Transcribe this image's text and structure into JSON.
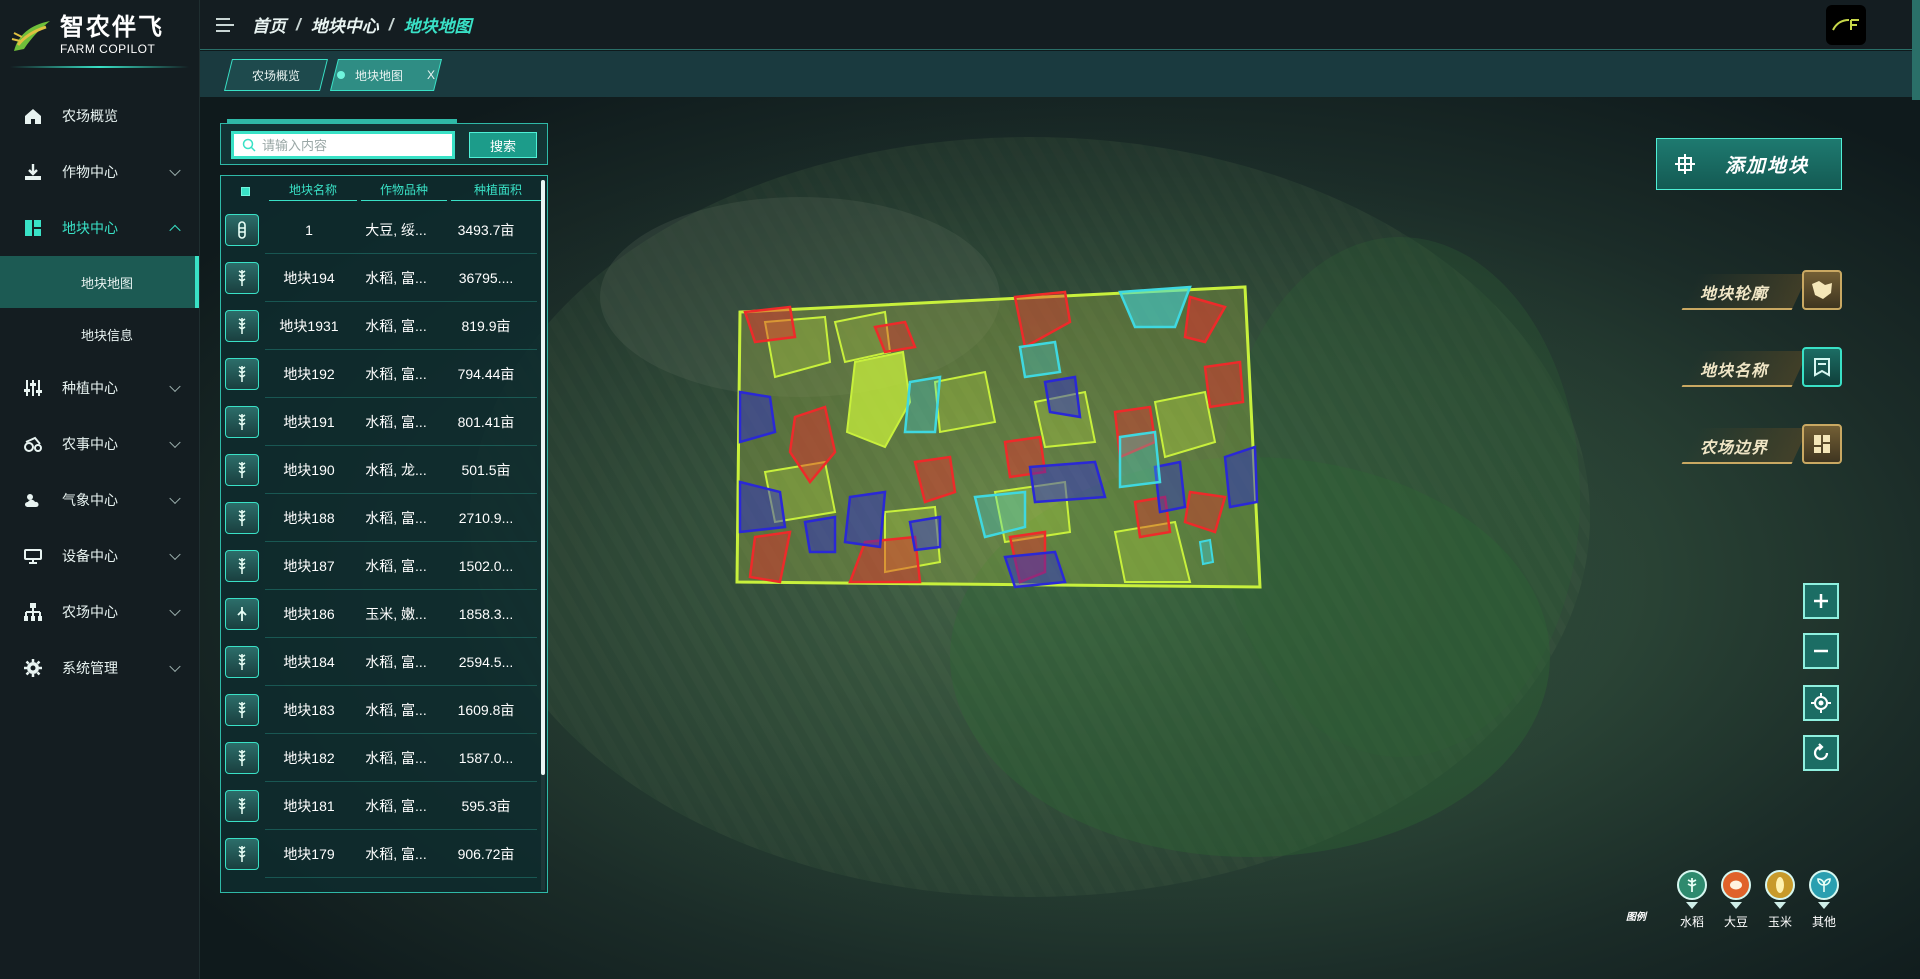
{
  "app": {
    "logo_title": "智农伴飞",
    "logo_sub": "FARM COPILOT"
  },
  "sidebar": {
    "items": [
      {
        "label": "农场概览",
        "icon": "home-icon",
        "expandable": false
      },
      {
        "label": "作物中心",
        "icon": "download-crop-icon",
        "expandable": true
      },
      {
        "label": "地块中心",
        "icon": "grid-blocks-icon",
        "expandable": true,
        "active": true
      },
      {
        "label": "种植中心",
        "icon": "sliders-icon",
        "expandable": true
      },
      {
        "label": "农事中心",
        "icon": "tractor-icon",
        "expandable": true
      },
      {
        "label": "气象中心",
        "icon": "weather-icon",
        "expandable": true
      },
      {
        "label": "设备中心",
        "icon": "device-icon",
        "expandable": true
      },
      {
        "label": "农场中心",
        "icon": "org-chart-icon",
        "expandable": true
      },
      {
        "label": "系统管理",
        "icon": "gear-icon",
        "expandable": true
      }
    ],
    "sub_items": [
      {
        "label": "地块地图",
        "active": true
      },
      {
        "label": "地块信息",
        "active": false
      }
    ]
  },
  "header": {
    "breadcrumb": [
      "首页",
      "地块中心",
      "地块地图"
    ],
    "separator": "/"
  },
  "tabs": [
    {
      "label": "农场概览",
      "active": false
    },
    {
      "label": "地块地图",
      "active": true,
      "close": "X"
    }
  ],
  "search": {
    "placeholder": "请输入内容",
    "button": "搜索"
  },
  "table": {
    "columns": [
      "地块名称",
      "作物品种",
      "种植面积"
    ],
    "rows": [
      {
        "name": "1",
        "crop": "大豆, 绥...",
        "area": "3493.7亩"
      },
      {
        "name": "地块194",
        "crop": "水稻, 富...",
        "area": "36795...."
      },
      {
        "name": "地块1931",
        "crop": "水稻, 富...",
        "area": "819.9亩"
      },
      {
        "name": "地块192",
        "crop": "水稻, 富...",
        "area": "794.44亩"
      },
      {
        "name": "地块191",
        "crop": "水稻, 富...",
        "area": "801.41亩"
      },
      {
        "name": "地块190",
        "crop": "水稻, 龙...",
        "area": "501.5亩"
      },
      {
        "name": "地块188",
        "crop": "水稻, 富...",
        "area": "2710.9..."
      },
      {
        "name": "地块187",
        "crop": "水稻, 富...",
        "area": "1502.0..."
      },
      {
        "name": "地块186",
        "crop": "玉米, 嫩...",
        "area": "1858.3..."
      },
      {
        "name": "地块184",
        "crop": "水稻, 富...",
        "area": "2594.5..."
      },
      {
        "name": "地块183",
        "crop": "水稻, 富...",
        "area": "1609.8亩"
      },
      {
        "name": "地块182",
        "crop": "水稻, 富...",
        "area": "1587.0..."
      },
      {
        "name": "地块181",
        "crop": "水稻, 富...",
        "area": "595.3亩"
      },
      {
        "name": "地块179",
        "crop": "水稻, 富...",
        "area": "906.72亩"
      }
    ]
  },
  "map_controls": {
    "add_plot": "添加地块",
    "layers": [
      "地块轮廓",
      "地块名称",
      "农场边界"
    ]
  },
  "legend": {
    "title": "图例",
    "items": [
      {
        "label": "水稻",
        "color": "#2e8a6e"
      },
      {
        "label": "大豆",
        "color": "#e0622a"
      },
      {
        "label": "玉米",
        "color": "#c89a2a"
      },
      {
        "label": "其他",
        "color": "#2a9fb0"
      }
    ]
  },
  "colors": {
    "accent": "#39e1c6",
    "plot_yellow": "#c8f03c",
    "plot_red": "#ee2a2a",
    "plot_blue": "#2a28d6",
    "plot_cyan": "#3fd8e0"
  }
}
